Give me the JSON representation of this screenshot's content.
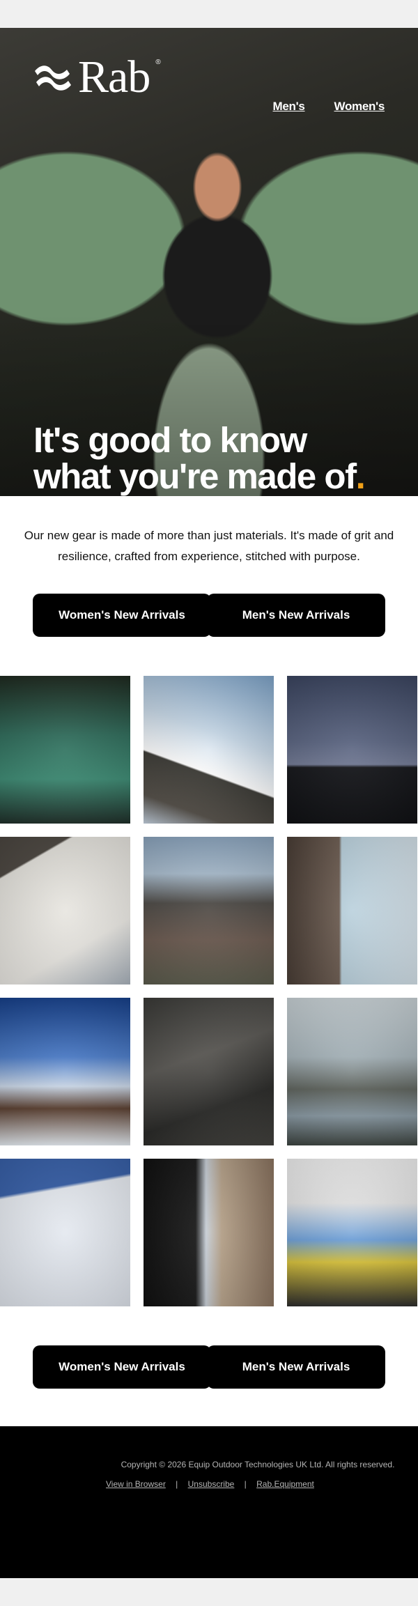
{
  "brand": {
    "name": "Rab",
    "reg": "®",
    "icon": "rab-wave-logo-icon"
  },
  "nav": {
    "mens": "Men's",
    "womens": "Women's"
  },
  "hero": {
    "line1": "It's good to know",
    "line2": "what you're made of",
    "dot": "."
  },
  "intro": "Our new gear is made of more than just materials. It's made of grit and resilience, crafted from experience, stitched with purpose.",
  "cta": {
    "womens": "Women's New Arrivals",
    "mens": "Men's New Arrivals"
  },
  "colors": {
    "accent": "#f0a018",
    "button": "#000000",
    "footer": "#000000"
  },
  "footer": {
    "copyright": "Copyright © 2026 Equip Outdoor Technologies UK Ltd. All rights reserved.",
    "view_browser": "View in Browser",
    "unsubscribe": "Unsubscribe",
    "site": "Rab.Equipment",
    "separator": "|"
  }
}
